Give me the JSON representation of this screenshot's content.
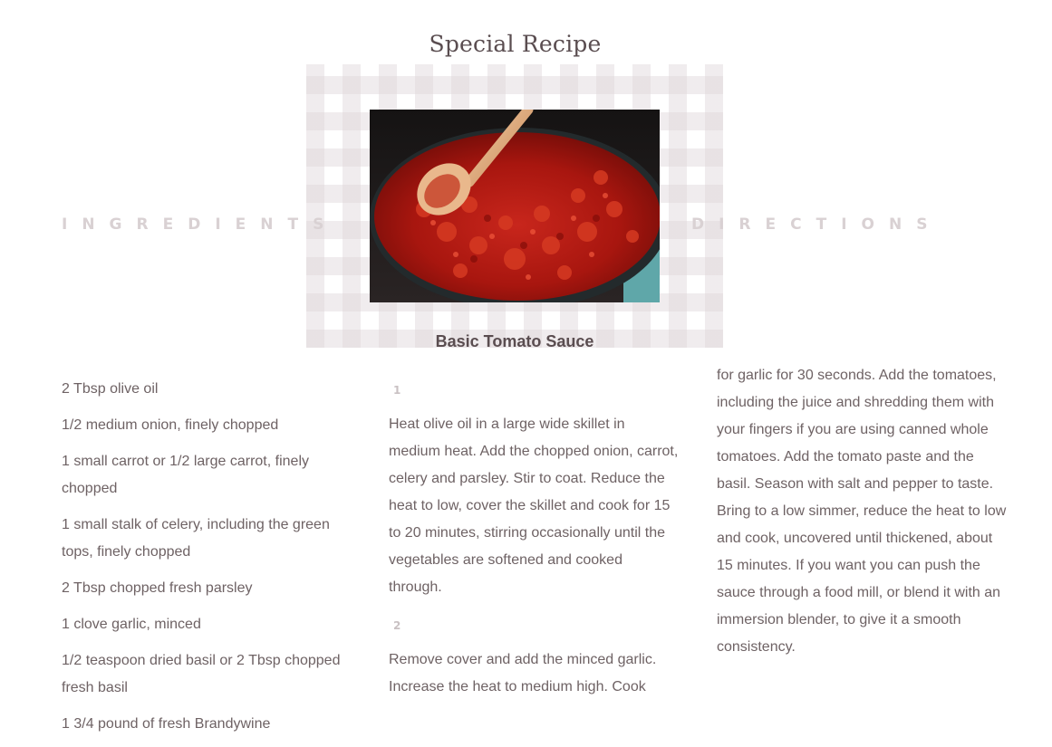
{
  "recipe": {
    "page_title": "Special Recipe",
    "name": "Basic Tomato Sauce"
  },
  "sections": {
    "ingredients_heading": "INGREDIENTS",
    "directions_heading": "DIRECTIONS"
  },
  "ingredients": [
    "2 Tbsp olive oil",
    "1/2 medium onion, finely chopped",
    "1 small carrot or 1/2 large carrot, finely chopped",
    "1 small stalk of celery, including the green tops, finely chopped",
    "2 Tbsp chopped fresh parsley",
    "1 clove garlic, minced",
    "1/2 teaspoon dried basil or 2 Tbsp chopped fresh basil",
    "1 3/4 pound of fresh Brandywine"
  ],
  "directions": {
    "steps": [
      {
        "number": "1",
        "text": "Heat olive oil in a large wide skillet in medium heat. Add the chopped onion, carrot, celery and parsley. Stir to coat. Reduce the heat to low, cover the skillet and cook for 15 to 20 minutes, stirring occasionally until the vegetables are softened and cooked through."
      },
      {
        "number": "2",
        "text": "Remove cover and add the minced garlic. Increase the heat to medium high. Cook"
      }
    ],
    "continued_text": "for garlic for 30 seconds. Add the tomatoes, including the juice and shredding them with your fingers if you are using canned whole tomatoes. Add the tomato paste and the basil. Season with salt and pepper to taste. Bring to a low simmer, reduce the heat to low and cook, uncovered until thickened, about 15 minutes. If you want you can push the sauce through a food mill, or blend it with an immersion blender, to give it a smooth consistency."
  },
  "colors": {
    "heading_text": "#5a4d50",
    "body_text": "#6e6264",
    "faint_heading": "#d9d1d3",
    "step_number": "#c9c1c3"
  },
  "image": {
    "subject": "tomato-sauce-skillet-photo"
  }
}
